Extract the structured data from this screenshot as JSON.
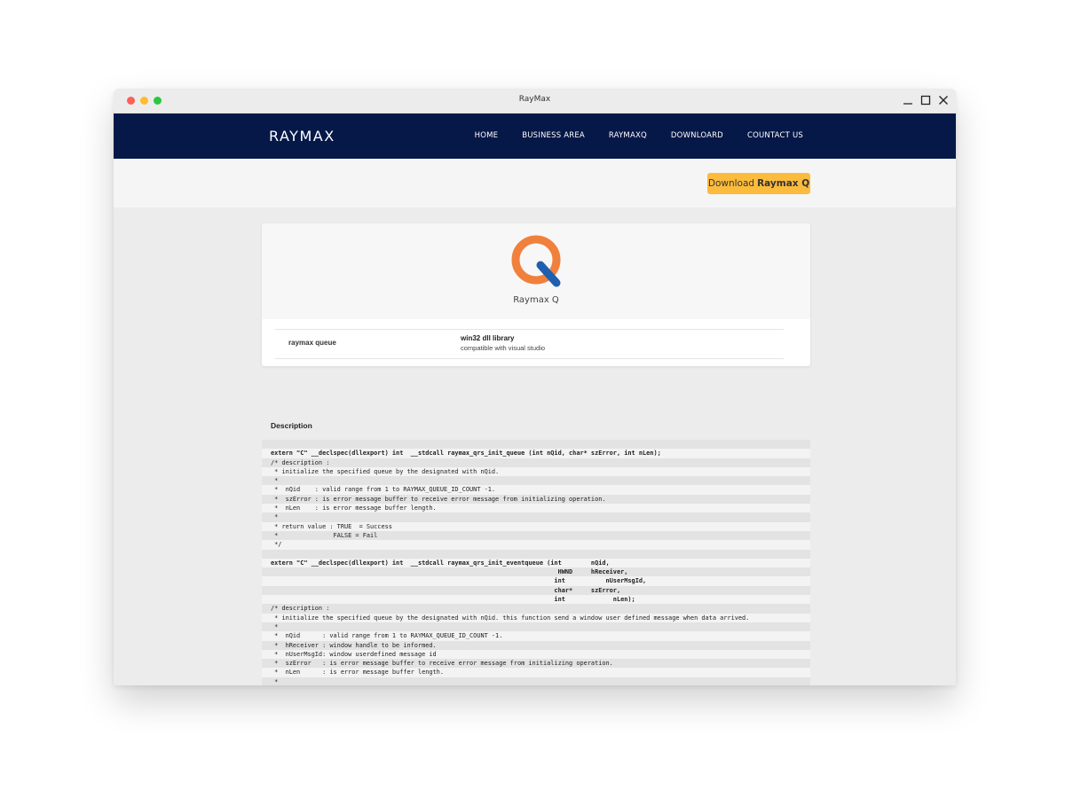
{
  "window": {
    "title": "RayMax"
  },
  "navbar": {
    "logo": "RAYMAX",
    "items": [
      "HOME",
      "BUSINESS AREA",
      "RAYMAXQ",
      "DOWNLOARD",
      "COUNTACT US"
    ]
  },
  "hero": {
    "download_prefix": "Download",
    "download_product": "Raymax Q"
  },
  "product": {
    "name": "Raymax Q",
    "logo_colors": {
      "ring": "#f0803c",
      "bar": "#1f5fb0"
    },
    "spec_key": "raymax queue",
    "spec_value_title": "win32 dll library",
    "spec_value_desc": "compatible with visual studio"
  },
  "description": {
    "title": "Description",
    "code_lines": [
      {
        "text": "",
        "bold": false
      },
      {
        "text": "extern \"C\" __declspec(dllexport) int  __stdcall raymax_qrs_init_queue (int nQid, char* szError, int nLen);",
        "bold": true
      },
      {
        "text": "/* description :",
        "bold": false
      },
      {
        "text": " * initialize the specified queue by the designated with nQid.",
        "bold": false
      },
      {
        "text": " *",
        "bold": false
      },
      {
        "text": " *  nQid    : valid range from 1 to RAYMAX_QUEUE_ID_COUNT -1.",
        "bold": false
      },
      {
        "text": " *  szError : is error message buffer to receive error message from initializing operation.",
        "bold": false
      },
      {
        "text": " *  nLen    : is error message buffer length.",
        "bold": false
      },
      {
        "text": " *",
        "bold": false
      },
      {
        "text": " * return value : TRUE  = Success",
        "bold": false
      },
      {
        "text": " *               FALSE = Fail",
        "bold": false
      },
      {
        "text": " */",
        "bold": false
      },
      {
        "text": "",
        "bold": false
      },
      {
        "text": "extern \"C\" __declspec(dllexport) int  __stdcall raymax_qrs_init_eventqueue (int        nQid,",
        "bold": true
      },
      {
        "text": "                                                                              HWND     hReceiver,",
        "bold": true
      },
      {
        "text": "                                                                             int           nUserMsgId,",
        "bold": true
      },
      {
        "text": "                                                                             char*     szError,",
        "bold": true
      },
      {
        "text": "                                                                             int             nLen);",
        "bold": true
      },
      {
        "text": "/* description :",
        "bold": false
      },
      {
        "text": " * initialize the specified queue by the designated with nQid. this function send a window user defined message when data arrived.",
        "bold": false
      },
      {
        "text": " *",
        "bold": false
      },
      {
        "text": " *  nQid      : valid range from 1 to RAYMAX_QUEUE_ID_COUNT -1.",
        "bold": false
      },
      {
        "text": " *  hReceiver : window handle to be informed.",
        "bold": false
      },
      {
        "text": " *  nUserMsgId: window userdefined message id",
        "bold": false
      },
      {
        "text": " *  szError   : is error message buffer to receive error message from initializing operation.",
        "bold": false
      },
      {
        "text": " *  nLen      : is error message buffer length.",
        "bold": false
      },
      {
        "text": " *",
        "bold": false
      }
    ]
  }
}
